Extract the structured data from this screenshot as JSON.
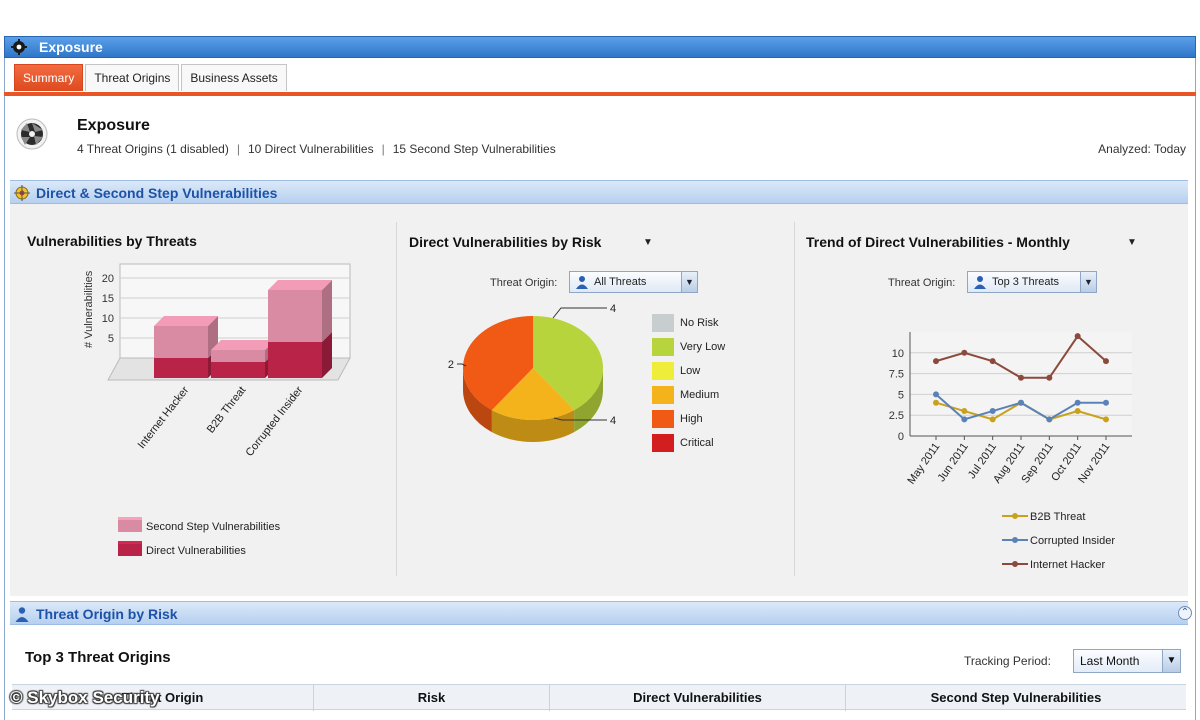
{
  "window": {
    "title": "Exposure",
    "icon": "gear-icon"
  },
  "tabs": [
    {
      "label": "Summary",
      "active": true
    },
    {
      "label": "Threat Origins",
      "active": false
    },
    {
      "label": "Business Assets",
      "active": false
    }
  ],
  "header": {
    "title": "Exposure",
    "summary": [
      "4 Threat Origins (1 disabled)",
      "10 Direct Vulnerabilities",
      "15 Second Step Vulnerabilities"
    ],
    "analyzed": "Analyzed: Today"
  },
  "section1": {
    "title": "Direct & Second Step Vulnerabilities",
    "icon": "target-icon"
  },
  "section2": {
    "title": "Threat Origin by Risk",
    "icon": "person-icon",
    "collapse_icon": "collapse-icon"
  },
  "colors": {
    "accent_orange": "#e95527",
    "section_blue": "#1d52a8",
    "bar_second_step": "#d98ba4",
    "bar_direct": "#b82347",
    "b2b": "#c9a21d",
    "corrupted_insider": "#5b82b8",
    "internet_hacker": "#8c4a3c"
  },
  "chart_data": [
    {
      "type": "bar",
      "title": "Vulnerabilities by Threats",
      "ylabel": "# Vulnerabilities",
      "categories": [
        "Internet Hacker",
        "B2B Threat",
        "Corrupted Insider"
      ],
      "stacked": true,
      "series": [
        {
          "name": "Direct Vulnerabilities",
          "values": [
            5,
            4,
            9
          ]
        },
        {
          "name": "Second Step Vulnerabilities",
          "values": [
            8,
            3,
            13
          ]
        }
      ],
      "yticks": [
        5,
        10,
        15,
        20
      ],
      "ylim": [
        0,
        23
      ],
      "legend": "bottom"
    },
    {
      "type": "pie",
      "title": "Direct Vulnerabilities by Risk",
      "filter_label": "Threat Origin:",
      "filter_value": "All Threats",
      "slices": [
        {
          "name": "No Risk",
          "value": 0,
          "color": "#c8cdd0"
        },
        {
          "name": "Very Low",
          "value": 4,
          "color": "#b7d43c"
        },
        {
          "name": "Low",
          "value": 0,
          "color": "#f0ec3a"
        },
        {
          "name": "Medium",
          "value": 2,
          "color": "#f4b21b"
        },
        {
          "name": "High",
          "value": 4,
          "color": "#f05a14"
        },
        {
          "name": "Critical",
          "value": 0,
          "color": "#d21e1e"
        }
      ],
      "data_labels": [
        "4",
        "2",
        "4"
      ],
      "legend": "right"
    },
    {
      "type": "line",
      "title": "Trend of Direct Vulnerabilities - Monthly",
      "filter_label": "Threat Origin:",
      "filter_value": "Top 3 Threats",
      "x": [
        "May 2011",
        "Jun 2011",
        "Jul 2011",
        "Aug 2011",
        "Sep 2011",
        "Oct 2011",
        "Nov 2011"
      ],
      "series": [
        {
          "name": "B2B Threat",
          "values": [
            4,
            3,
            2,
            4,
            2,
            3,
            2
          ]
        },
        {
          "name": "Corrupted Insider",
          "values": [
            5,
            2,
            3,
            4,
            2,
            4,
            4
          ]
        },
        {
          "name": "Internet Hacker",
          "values": [
            9,
            10,
            9,
            7,
            7,
            12,
            9
          ]
        }
      ],
      "yticks": [
        "0",
        "2.5",
        "5",
        "7.5",
        "10"
      ],
      "ylim": [
        0,
        12.5
      ],
      "legend": "bottom"
    }
  ],
  "bottom": {
    "title": "Top 3 Threat Origins",
    "tracking_label": "Tracking Period:",
    "tracking_value": "Last Month",
    "columns": [
      "Threat Origin",
      "Risk",
      "Direct Vulnerabilities",
      "Second Step Vulnerabilities"
    ]
  },
  "watermark": "© Skybox Security"
}
